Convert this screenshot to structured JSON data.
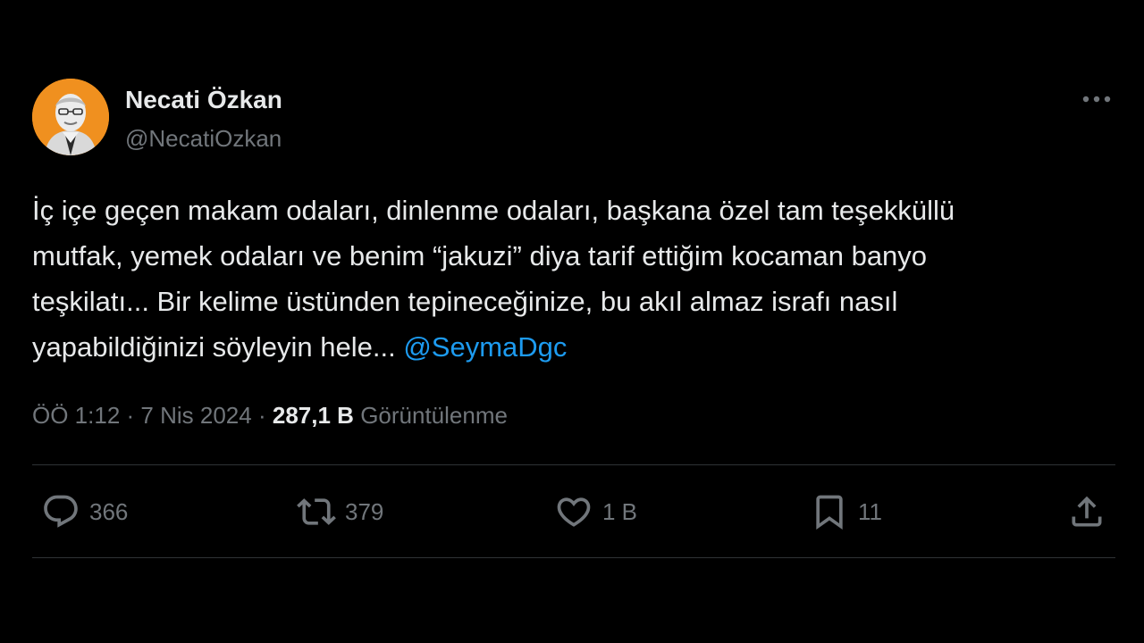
{
  "author": {
    "name": "Necati Özkan",
    "handle": "@NecatiOzkan"
  },
  "tweet": {
    "lines": [
      "İç içe geçen makam odaları, dinlenme odaları, başkana özel tam teşekküllü",
      "mutfak, yemek odaları ve benim “jakuzi” diya tarif ettiğim kocaman banyo",
      "teşkilatı... Bir kelime üstünden tepineceğinize, bu akıl almaz israfı nasıl",
      "yapabildiğinizi söyleyin hele..."
    ],
    "mention": "@SeymaDgc"
  },
  "meta": {
    "time": "ÖÖ 1:12",
    "date": "7 Nis 2024",
    "separator": "·",
    "views_count": "287,1 B",
    "views_label": "Görüntülenme"
  },
  "actions": {
    "reply": {
      "icon": "reply-icon",
      "count": "366"
    },
    "retweet": {
      "icon": "retweet-icon",
      "count": "379"
    },
    "like": {
      "icon": "heart-icon",
      "count": "1 B"
    },
    "bookmark": {
      "icon": "bookmark-icon",
      "count": "11"
    },
    "share": {
      "icon": "share-icon"
    }
  },
  "colors": {
    "background": "#000000",
    "text": "#e7e9ea",
    "muted": "#71767b",
    "link": "#1d9bf0",
    "divider": "#2f3336",
    "avatar_bg": "#f0901f"
  }
}
